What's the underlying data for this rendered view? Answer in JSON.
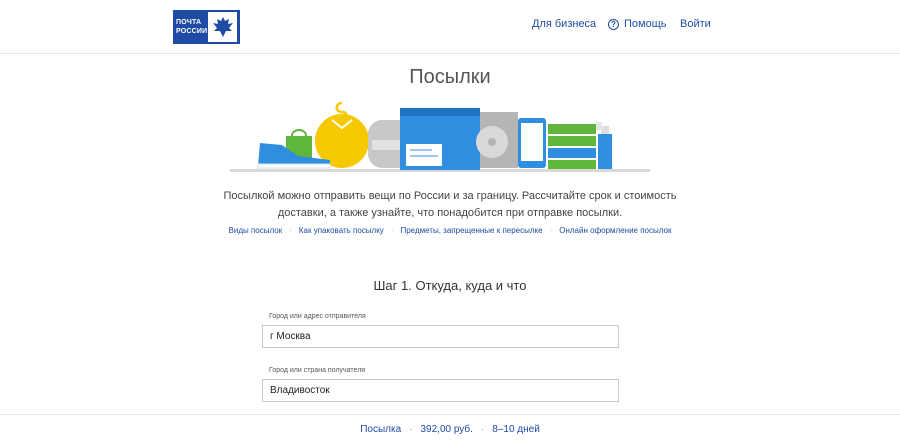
{
  "header": {
    "logo_text": "ПОЧТА РОССИИ",
    "nav": {
      "business": "Для бизнеса",
      "help": "Помощь",
      "login": "Войти"
    }
  },
  "page": {
    "title": "Посылки",
    "description": "Посылкой можно отправить вещи по России и за границу. Рассчитайте срок и стоимость доставки, а также узнайте, что понадобится при отправке посылки.",
    "links": [
      "Виды посылок",
      "Как упаковать посылку",
      "Предметы, запрещенные к пересылке",
      "Онлайн оформление посылок"
    ]
  },
  "form": {
    "step_title": "Шаг 1. Откуда, куда и что",
    "from_label": "Город или адрес отправителя",
    "from_value": "г Москва",
    "to_label": "Город или страна получателя",
    "to_value": "Владивосток"
  },
  "summary": {
    "type": "Посылка",
    "price": "392,00 руб.",
    "term": "8–10 дней"
  },
  "colors": {
    "brand": "#1f4ba5",
    "illustration_blue": "#2f8ee0",
    "illustration_yellow": "#f5c800",
    "illustration_green": "#5fb63a"
  },
  "icons": {
    "logo": "russian-post-eagle",
    "help": "question-circle-icon"
  }
}
